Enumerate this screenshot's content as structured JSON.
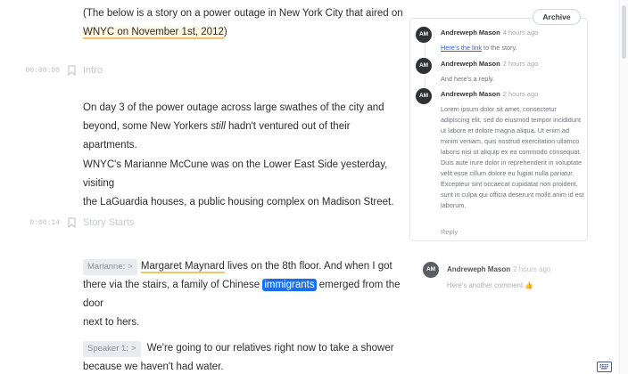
{
  "transcript": {
    "intro_line1": "(The below is a story on a power outage in New York City that aired on",
    "intro_line2": "WNYC on November 1st, 2012",
    "intro_line2_tail": ")",
    "sections": [
      {
        "time": "00:00:00",
        "title": "Intro"
      },
      {
        "time": "0:00:14",
        "title": "Story Starts"
      }
    ],
    "para1_a": "On day 3 of the power outage across large swathes of the city and",
    "para1_b": "beyond, some New Yorkers ",
    "para1_italic": "still",
    "para1_c": " hadn't ventured out of their apartments.",
    "para2_a": "WNYC's Marianne McCune was on the Lower East Side yesterday, visiting",
    "para2_b": "the LaGuardia houses, a public housing complex on Madison Street.",
    "speaker1": "Marianne:",
    "para3_name": "Margaret Maynard",
    "para3_a": " lives on the 8th floor. And when I got",
    "para3_b": "there via the stairs, a family of Chinese ",
    "para3_highlight": "immigrants",
    "para3_c": " emerged from the door",
    "para3_d": "next to hers.",
    "speaker2": "Speaker 1:",
    "para4_a": " We're going to our relatives right now to take a shower",
    "para4_b": "because we haven't had water."
  },
  "comments": {
    "archive_label": "Archive",
    "thread": [
      {
        "initials": "AM",
        "name": "Andreweph Mason",
        "time": "4 hours ago",
        "link": "Here's the link",
        "body": " to the story."
      },
      {
        "initials": "AM",
        "name": "Andreweph Mason",
        "time": "2 hours ago",
        "body": "And here's a reply."
      },
      {
        "initials": "AM",
        "name": "Andreweph Mason",
        "time": "2 hours ago",
        "body": "Lorem ipsum dolor sit amet, consectetur adipiscing elit, sed do eiusmod tempor incididunt ut labore et dolore magna aliqua. Ut enim ad minim veniam, quis nostrud exercitation ullamco laboris nisi ut aliquip ex ea commodo consequat. Duis aute irure dolor in reprehenderit in voluptate velit esse cillum dolore eu fugiat nulla pariatur. Excepteur sint occaecat cupidatat non proident, sunt in culpa qui officia deserunt mollit anim id est laborum."
      }
    ],
    "reply_label": "Reply",
    "second": {
      "initials": "AM",
      "name": "Andreweph Mason",
      "time": "2 hours ago",
      "body": "Here's another comment 👍"
    }
  },
  "icons": {
    "bookmark": "bookmark-icon",
    "keyboard": "keyboard-icon"
  },
  "colors": {
    "highlight_blue": "#1a6ef0",
    "highlight_yellow": "#f2c46a"
  }
}
